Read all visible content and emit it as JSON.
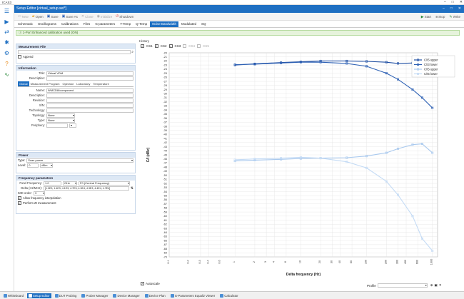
{
  "app": {
    "title": "ICAS3"
  },
  "editor": {
    "title": "Setup Editor [virtual_setup.set*]"
  },
  "toolbar": {
    "buttons": [
      {
        "label": "New",
        "icon": "new-file-icon",
        "enabled": false
      },
      {
        "label": "Open",
        "icon": "open-folder-icon",
        "enabled": true
      },
      {
        "label": "Save",
        "icon": "save-icon",
        "enabled": true
      },
      {
        "label": "Save As",
        "icon": "save-as-icon",
        "enabled": true
      },
      {
        "label": "Close",
        "icon": "close-icon",
        "enabled": false
      },
      {
        "label": "Initialize",
        "icon": "initialize-icon",
        "enabled": false
      },
      {
        "label": "Shutdown",
        "icon": "shutdown-icon",
        "enabled": true
      }
    ],
    "right": [
      {
        "label": "Start",
        "icon": "play-icon"
      },
      {
        "label": "Stop",
        "icon": "stop-icon"
      },
      {
        "label": "Write",
        "icon": "write-icon"
      }
    ]
  },
  "tabs": [
    "Schematic",
    "Oscillograms",
    "Calibrations",
    "Files",
    "G-parameters",
    "Y-Temp",
    "Q-Temp",
    "Noise Bandwidth",
    "Modulated",
    "SQ"
  ],
  "active_tab": "Noise Bandwidth",
  "message": "1-Port Enhanced calibration used (ON)",
  "measurement_file": {
    "header": "Measurement File",
    "search_placeholder": "",
    "append_label": "Append"
  },
  "information": {
    "header": "Information",
    "title_label": "Title:",
    "title_value": "Virtual VDM",
    "description_label": "Description:",
    "description_value": "",
    "subtabs": [
      "Global",
      "Measurement Program",
      "Operator",
      "Laboratory",
      "Temperature"
    ],
    "name_label": "Name:",
    "name_value": "WMCD8/component",
    "fields": [
      {
        "label": "Description:",
        "value": ""
      },
      {
        "label": "Revision:",
        "value": ""
      },
      {
        "label": "S/N:",
        "value": ""
      },
      {
        "label": "Technology:",
        "value": ""
      }
    ],
    "dropdowns": [
      {
        "label": "Topology:",
        "value": "None"
      },
      {
        "label": "Type:",
        "value": "None"
      },
      {
        "label": "Periphery:",
        "value": ""
      }
    ]
  },
  "power": {
    "header": "Power",
    "type_label": "Type:",
    "type_value": "Scan power",
    "level_label": "Level:",
    "level_value": "0",
    "level_unit": "dBm"
  },
  "frequency": {
    "header": "Frequency parameters",
    "fund_label": "Fund Frequency:",
    "fund_value": "1.0",
    "fund_unit": "GHz",
    "fund_mode": "F0 (Central Frequency)",
    "delta_label": "Delta (Hz/MHz):",
    "delta_value": "[1.0E3; 1.4E3; 4.1E3; 4.7E3; 4.3E4; 4.3E3; 4.4E4; 4.7E4]",
    "imd_label": "IMD order:",
    "imd_value": "3",
    "allow_interp": "Allow frequency interpolation",
    "perform_meas": "Perform Zt measurement"
  },
  "display": {
    "history_label": "History",
    "stages": [
      {
        "label": "CS1",
        "checked": true,
        "enabled": true
      },
      {
        "label": "CS2",
        "checked": true,
        "enabled": true
      },
      {
        "label": "CS3",
        "checked": true,
        "enabled": true
      },
      {
        "label": "CS4",
        "checked": false,
        "enabled": false
      },
      {
        "label": "CS5",
        "checked": false,
        "enabled": false
      }
    ],
    "autoscale_label": "Autoscale",
    "profile_label": "Profile"
  },
  "chart_data": {
    "type": "line",
    "title": "",
    "xlabel": "Delta frequency (Hz)",
    "ylabel": "C/I (dBc)",
    "x_scale": "log",
    "xlim": [
      0.1,
      1200
    ],
    "ylim": [
      -70,
      -20
    ],
    "yticks": [
      -20,
      -21,
      -22,
      -23,
      -24,
      -25,
      -26,
      -27,
      -28,
      -29,
      -30,
      -31,
      -32,
      -33,
      -34,
      -35,
      -36,
      -37,
      -38,
      -39,
      -40,
      -41,
      -42,
      -43,
      -44,
      -45,
      -46,
      -47,
      -48,
      -49,
      -50,
      -51,
      -52,
      -53,
      -54,
      -55,
      -56,
      -57,
      -58,
      -59,
      -60,
      -61,
      -62,
      -63,
      -64,
      -65,
      -66,
      -67,
      -68,
      -69,
      -70
    ],
    "xticks": [
      "0.1",
      "0.2",
      "0.3",
      "0.4",
      "0.6",
      "1",
      "2",
      "3",
      "4",
      "6",
      "10",
      "20",
      "30",
      "40",
      "60",
      "100",
      "200",
      "300",
      "400",
      "600",
      "1000"
    ],
    "grid": true,
    "legend_position": "top-right",
    "series": [
      {
        "name": "C/I5 upper",
        "color": "#1e4ea3",
        "marker": true,
        "x": [
          1,
          2,
          5,
          10,
          20,
          50,
          100,
          200,
          300,
          500,
          700,
          1000
        ],
        "y": [
          -23.0,
          -22.7,
          -22.4,
          -22.2,
          -22.0,
          -22.0,
          -22.1,
          -22.3,
          -22.6,
          -22.5,
          -22.4,
          -22.5
        ]
      },
      {
        "name": "C/I3 lower",
        "color": "#2f62b5",
        "marker": true,
        "x": [
          1,
          2,
          5,
          10,
          20,
          50,
          100,
          200,
          300,
          500,
          700,
          1000
        ],
        "y": [
          -22.9,
          -22.8,
          -22.5,
          -22.3,
          -22.3,
          -22.6,
          -23.3,
          -25.0,
          -26.5,
          -29.0,
          -31.0,
          -33.5
        ]
      },
      {
        "name": "C/I5 upper",
        "color": "#a9c9ee",
        "marker": true,
        "x": [
          1,
          2,
          5,
          10,
          20,
          50,
          100,
          200,
          300,
          500,
          700,
          1000
        ],
        "y": [
          -46.5,
          -46.3,
          -46.1,
          -45.9,
          -45.8,
          -45.7,
          -45.3,
          -44.5,
          -43.5,
          -42.5,
          -42.3,
          -44.5
        ]
      },
      {
        "name": "C/I5 lower",
        "color": "#c4dbf5",
        "marker": true,
        "x": [
          1,
          2,
          5,
          10,
          20,
          50,
          100,
          200,
          300,
          500,
          700,
          1000
        ],
        "y": [
          -46.2,
          -46.0,
          -45.8,
          -45.6,
          -45.8,
          -46.7,
          -48.2,
          -51.5,
          -54.8,
          -60.0,
          -65.5,
          -68.5
        ]
      }
    ]
  },
  "bottom_tabs": [
    "Whiteboard",
    "Setup Editor",
    "DUT Probing",
    "Prober Manager",
    "Device Manager",
    "Device Plan",
    "G-Parameters Equaliz Viewer",
    "Calculator"
  ],
  "bottom_active": "Setup Editor"
}
